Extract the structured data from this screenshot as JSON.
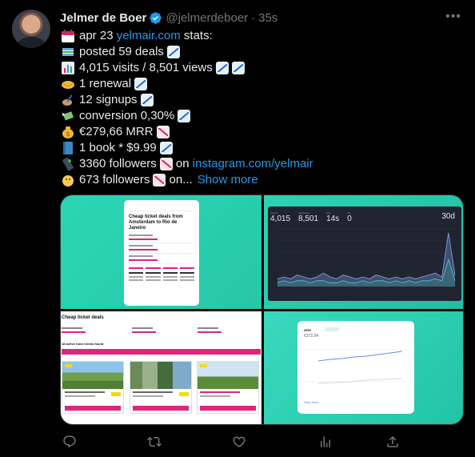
{
  "tweet": {
    "author_name": "Jelmer de Boer",
    "handle": "@jelmerdeboer",
    "separator": "·",
    "time": "35s",
    "lines": [
      {
        "emoji": "calendar-emoji",
        "parts": [
          "apr 23 ",
          "yelmair.com",
          " stats:"
        ],
        "badges": []
      },
      {
        "emoji": "flag-emoji",
        "text": "posted 59 deals",
        "badges": [
          "down"
        ]
      },
      {
        "emoji": "bar-chart-emoji",
        "text": "4,015 visits / 8,501 views",
        "badges": [
          "down",
          "down"
        ]
      },
      {
        "emoji": "handshake-emoji",
        "text": "1 renewal",
        "badges": [
          "down"
        ]
      },
      {
        "emoji": "writing-hand-emoji",
        "text": "12 signups",
        "badges": [
          "down"
        ]
      },
      {
        "emoji": "money-wings-emoji",
        "text": "conversion 0,30%",
        "badges": [
          "down"
        ]
      },
      {
        "emoji": "money-bag-emoji",
        "text": "€279,66 MRR",
        "badges": [
          "up"
        ]
      },
      {
        "emoji": "blue-book-emoji",
        "text": "1 book * $9.99",
        "badges": [
          "down"
        ]
      },
      {
        "emoji": "phone-emoji",
        "parts": [
          "3360 followers",
          " on ",
          "instagram.com/yelmair"
        ],
        "badges": [
          "up"
        ]
      },
      {
        "emoji": "chick-emoji",
        "parts": [
          "673 followers",
          " on...",
          "Show more"
        ],
        "badges": [
          "up"
        ]
      }
    ]
  },
  "media": {
    "tile1": {
      "title": "Cheap ticket deals from Amsterdam to Rio de Janeiro"
    },
    "tile2": {
      "stats": [
        {
          "label": "visitors",
          "value": "4,015"
        },
        {
          "label": "pageviews",
          "value": "8,501"
        },
        {
          "label": "time",
          "value": "14s"
        },
        {
          "label": "live",
          "value": "0"
        }
      ],
      "range": "30d",
      "chart_data": {
        "type": "area",
        "series": [
          {
            "values": [
              4,
              5,
              4,
              6,
              5,
              4,
              5,
              7,
              5,
              4,
              6,
              5,
              4,
              5,
              4,
              6,
              5,
              4,
              5,
              4,
              5,
              4,
              5,
              6,
              7,
              5,
              28,
              6
            ]
          },
          {
            "values": [
              2,
              3,
              2,
              3,
              3,
              2,
              3,
              3,
              2,
              2,
              3,
              2,
              2,
              3,
              2,
              3,
              3,
              2,
              3,
              2,
              3,
              2,
              3,
              3,
              4,
              3,
              14,
              3
            ]
          }
        ]
      }
    },
    "tile3": {
      "title": "Cheap ticket deals",
      "count_text": "18 active travel deals found"
    },
    "tile4": {
      "title": "MRR",
      "value": "€272.34",
      "footer": "View more"
    }
  },
  "colors": {
    "accent": "#1d9bf0",
    "muted": "#71767b",
    "teal": "#2bd6b4",
    "pink": "#e0247a"
  },
  "actions": [
    {
      "name": "reply-icon"
    },
    {
      "name": "retweet-icon"
    },
    {
      "name": "like-icon"
    },
    {
      "name": "views-icon"
    },
    {
      "name": "share-icon"
    }
  ]
}
